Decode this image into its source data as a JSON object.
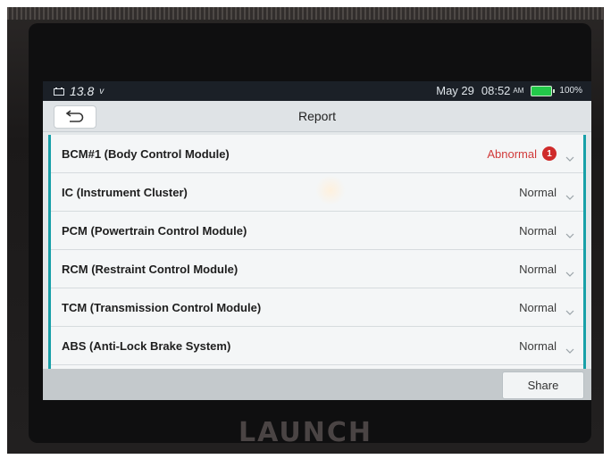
{
  "device": {
    "brand": "LAUNCH"
  },
  "statusbar": {
    "voltage": "13.8",
    "voltage_unit": "v",
    "date": "May 29",
    "time": "08:52",
    "ampm": "AM",
    "battery_percent": "100%"
  },
  "header": {
    "title": "Report",
    "back_icon": "back-arrow-icon"
  },
  "modules": [
    {
      "name": "BCM#1 (Body Control Module)",
      "status": "Abnormal",
      "badge": "1"
    },
    {
      "name": "IC (Instrument Cluster)",
      "status": "Normal"
    },
    {
      "name": "PCM (Powertrain Control Module)",
      "status": "Normal"
    },
    {
      "name": "RCM (Restraint Control Module)",
      "status": "Normal"
    },
    {
      "name": "TCM (Transmission Control Module)",
      "status": "Normal"
    },
    {
      "name": "ABS (Anti-Lock Brake System)",
      "status": "Normal"
    }
  ],
  "footer": {
    "share_label": "Share"
  },
  "colors": {
    "abnormal": "#d13a3a",
    "accent": "#18a0a8",
    "battery": "#23c94a"
  }
}
